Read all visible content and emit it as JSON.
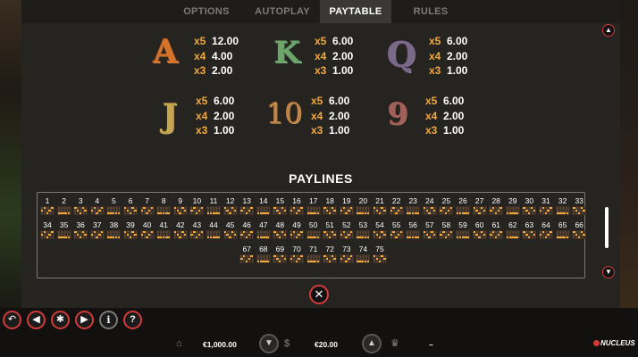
{
  "tabs": [
    {
      "label": "OPTIONS",
      "active": false
    },
    {
      "label": "AUTOPLAY",
      "active": false
    },
    {
      "label": "PAYTABLE",
      "active": true
    },
    {
      "label": "RULES",
      "active": false
    }
  ],
  "symbols": [
    {
      "glyph": "A",
      "pays": [
        {
          "mult": "x5",
          "amount": "12.00"
        },
        {
          "mult": "x4",
          "amount": "4.00"
        },
        {
          "mult": "x3",
          "amount": "2.00"
        }
      ]
    },
    {
      "glyph": "K",
      "pays": [
        {
          "mult": "x5",
          "amount": "6.00"
        },
        {
          "mult": "x4",
          "amount": "2.00"
        },
        {
          "mult": "x3",
          "amount": "1.00"
        }
      ]
    },
    {
      "glyph": "Q",
      "pays": [
        {
          "mult": "x5",
          "amount": "6.00"
        },
        {
          "mult": "x4",
          "amount": "2.00"
        },
        {
          "mult": "x3",
          "amount": "1.00"
        }
      ]
    },
    {
      "glyph": "J",
      "pays": [
        {
          "mult": "x5",
          "amount": "6.00"
        },
        {
          "mult": "x4",
          "amount": "2.00"
        },
        {
          "mult": "x3",
          "amount": "1.00"
        }
      ]
    },
    {
      "glyph": "10",
      "pays": [
        {
          "mult": "x5",
          "amount": "6.00"
        },
        {
          "mult": "x4",
          "amount": "2.00"
        },
        {
          "mult": "x3",
          "amount": "1.00"
        }
      ]
    },
    {
      "glyph": "9",
      "pays": [
        {
          "mult": "x5",
          "amount": "6.00"
        },
        {
          "mult": "x4",
          "amount": "2.00"
        },
        {
          "mult": "x3",
          "amount": "1.00"
        }
      ]
    }
  ],
  "paylines": {
    "title": "PAYLINES",
    "count": 75
  },
  "icons": {
    "scroll_up": "chevron-up-icon",
    "scroll_down": "chevron-down-icon",
    "close": "close-icon",
    "back": "back-arrow-icon",
    "sound": "speaker-icon",
    "settings": "gear-icon",
    "autoplay": "play-icon",
    "info": "info-icon",
    "help": "question-icon",
    "balance": "bank-icon",
    "bet": "coins-icon",
    "win": "trophy-icon"
  },
  "bottom_bar": {
    "balance": "€1,000.00",
    "bet": "€20.00",
    "win": "–",
    "logo": "NUCLEUS"
  },
  "colors": {
    "accent_red": "#d23a3a",
    "multiplier_orange": "#f1a93a",
    "panel_bg": "#262421"
  }
}
